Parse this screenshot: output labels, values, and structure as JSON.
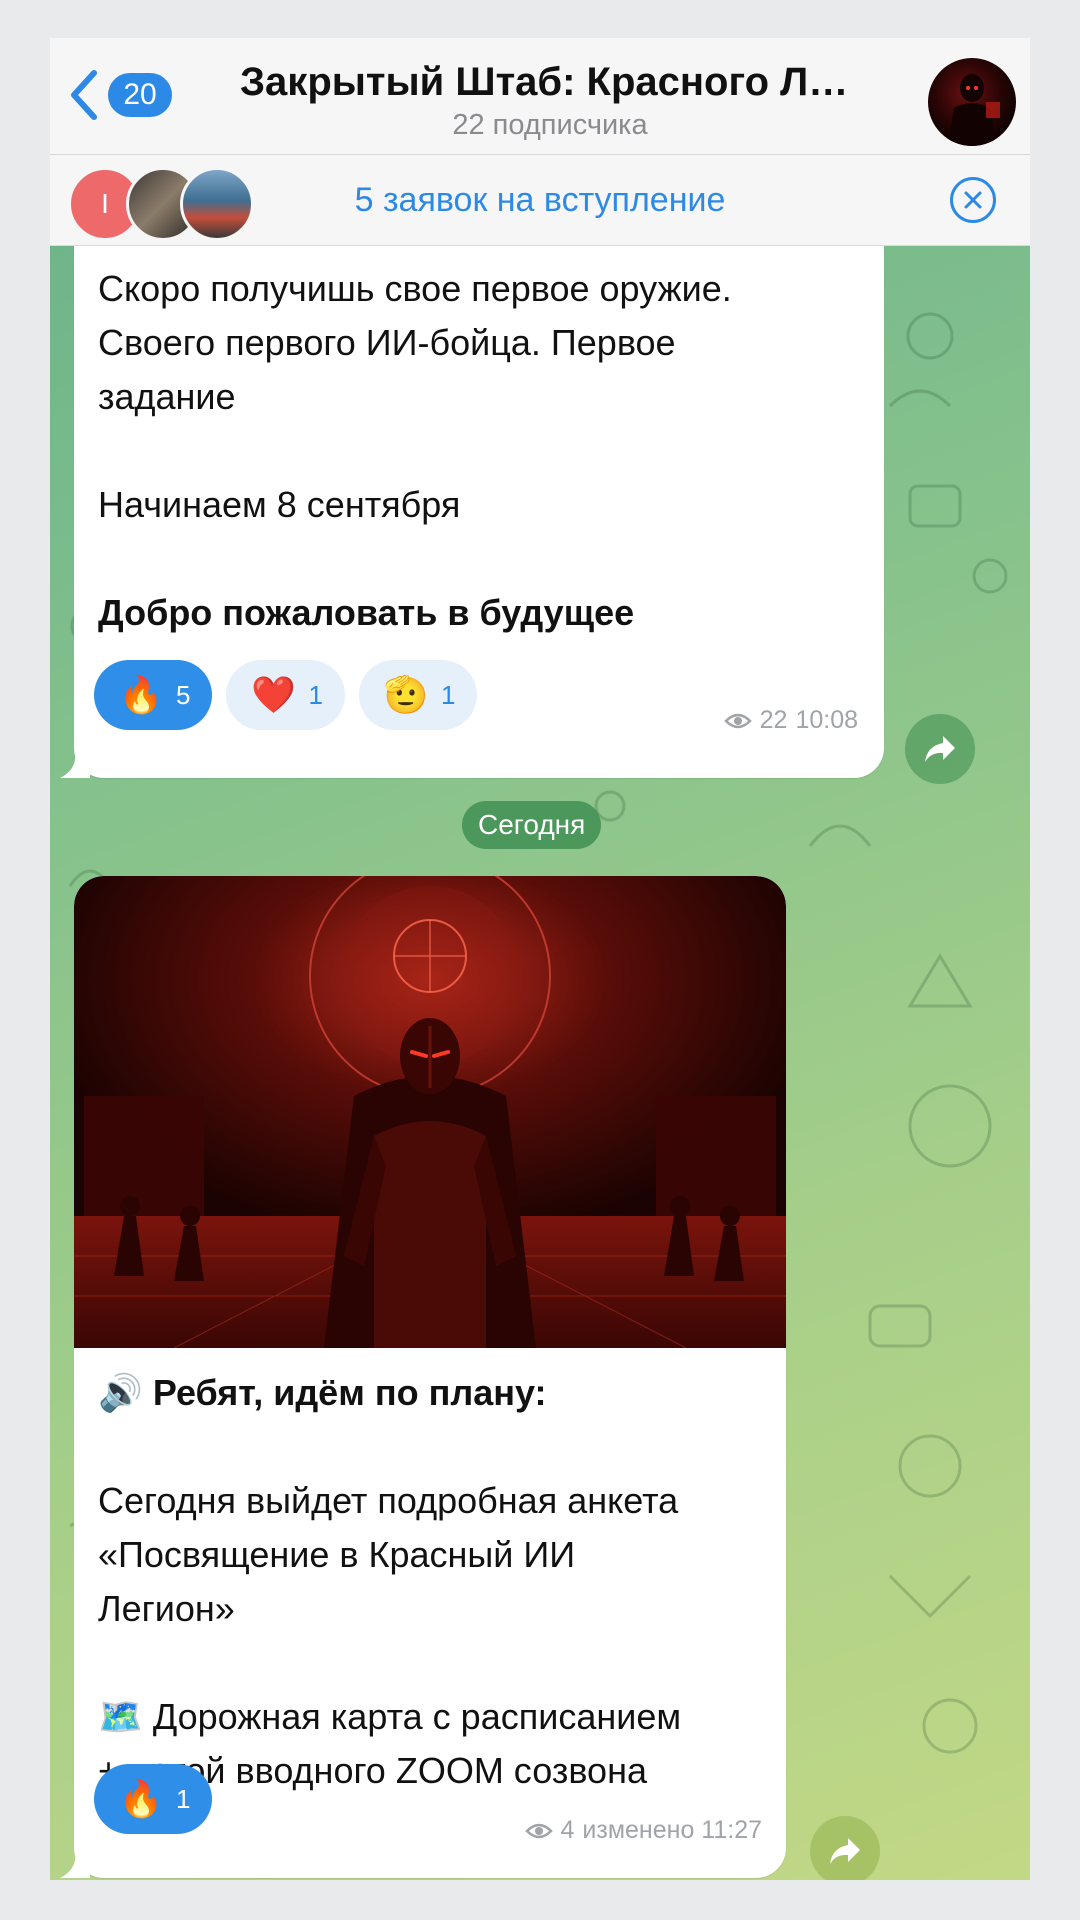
{
  "header": {
    "back_count": "20",
    "title": "Закрытый Штаб: Красного Ле...",
    "subtitle": "22 подписчика"
  },
  "requests": {
    "first_avatar_letter": "I",
    "text": "5 заявок на вступление"
  },
  "message1": {
    "lines": [
      "Скоро получишь свое первое оружие.",
      "Своего первого ИИ-бойца. Первое",
      "задание",
      "Начинаем 8 сентября",
      "Добро пожаловать в будущее"
    ],
    "reactions": [
      {
        "emoji": "🔥",
        "count": "5"
      },
      {
        "emoji": "❤️",
        "count": "1"
      },
      {
        "emoji": "🫡",
        "count": "1"
      }
    ],
    "views": "22",
    "time": "10:08"
  },
  "date_separator": "Сегодня",
  "message2": {
    "heading_icon": "🔊",
    "heading": "Ребят, идём по плану:",
    "lines": [
      "Сегодня выйдет подробная анкета",
      "«Посвящение в Красный ИИ",
      "Легион»",
      "Дорожная карта с расписанием",
      "+ датой вводного ZOOM созвона"
    ],
    "map_icon": "🗺️",
    "reactions": [
      {
        "emoji": "🔥",
        "count": "1"
      }
    ],
    "views": "4",
    "edited_time": "изменено 11:27"
  },
  "colors": {
    "accent": "#2c8ae6",
    "chat_bg_top": "#6fb58a",
    "chat_bg_bottom": "#c2d886"
  }
}
